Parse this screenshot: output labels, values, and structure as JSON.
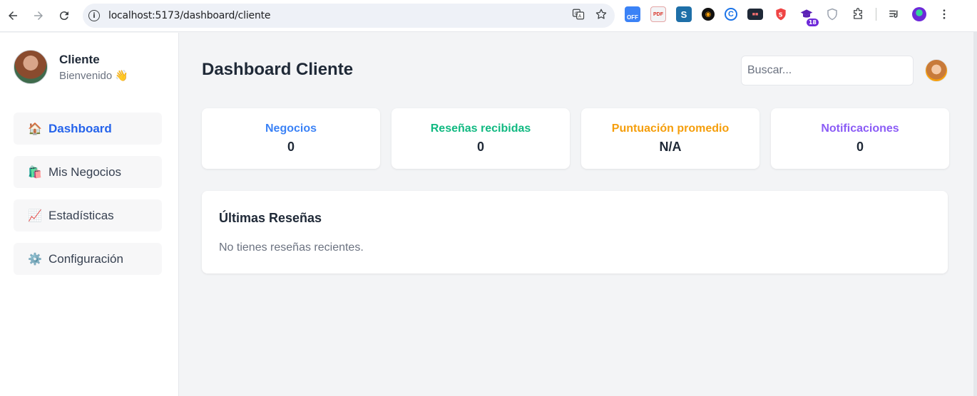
{
  "browser": {
    "url": "localhost:5173/dashboard/cliente",
    "extensions": [
      "off-ext-icon",
      "pdf-ext-icon",
      "s-ext-icon",
      "circle-ext-icon",
      "copyright-ext-icon",
      "monitor-ext-icon",
      "shield-red-ext-icon",
      "cap-ext-icon",
      "shield-gray-ext-icon"
    ],
    "off_label": "OFF",
    "cap_badge": "18"
  },
  "sidebar": {
    "user_name": "Cliente",
    "welcome": "Bienvenido",
    "welcome_emoji": "👋",
    "items": [
      {
        "icon": "🏠",
        "label": "Dashboard",
        "active": true
      },
      {
        "icon": "🛍️",
        "label": "Mis Negocios",
        "active": false
      },
      {
        "icon": "📈",
        "label": "Estadísticas",
        "active": false
      },
      {
        "icon": "⚙️",
        "label": "Configuración",
        "active": false
      }
    ]
  },
  "header": {
    "title": "Dashboard Cliente",
    "search_placeholder": "Buscar..."
  },
  "stats": [
    {
      "label": "Negocios",
      "value": "0",
      "color": "#3b82f6"
    },
    {
      "label": "Reseñas recibidas",
      "value": "0",
      "color": "#10b981"
    },
    {
      "label": "Puntuación promedio",
      "value": "N/A",
      "color": "#f59e0b"
    },
    {
      "label": "Notificaciones",
      "value": "0",
      "color": "#8b5cf6"
    }
  ],
  "reviews": {
    "title": "Últimas Reseñas",
    "empty_message": "No tienes reseñas recientes."
  }
}
